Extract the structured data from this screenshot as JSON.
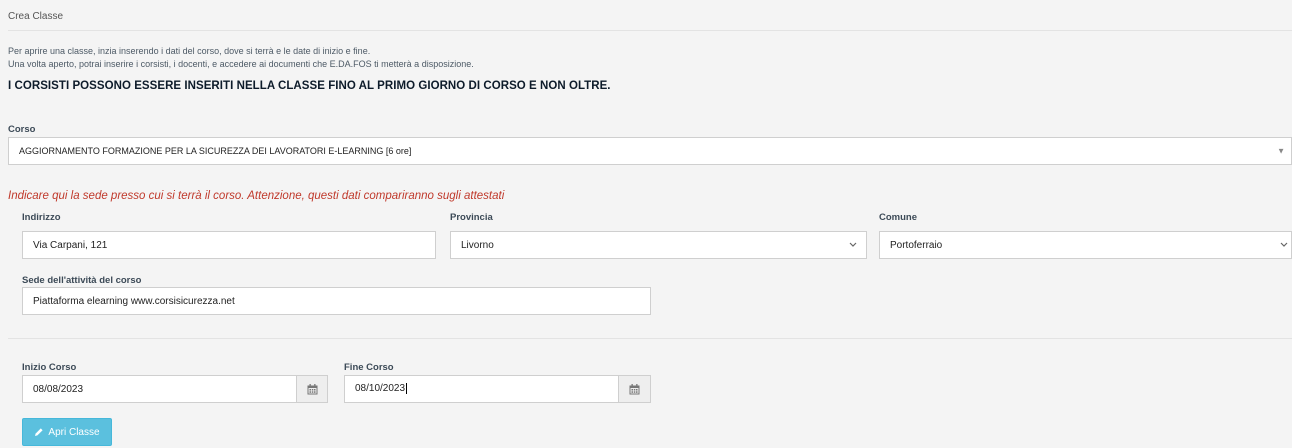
{
  "panel": {
    "title": "Crea Classe"
  },
  "intro": {
    "line1": "Per aprire una classe, inzia inserendo i dati del corso, dove si terrà e le date di inizio e fine.",
    "line2": "Una volta aperto, potrai inserire i corsisti, i docenti, e accedere ai documenti che E.DA.FOS ti metterà a disposizione.",
    "warning": "I CORSISTI POSSONO ESSERE INSERITI NELLA CLASSE FINO AL PRIMO GIORNO DI CORSO E NON OLTRE."
  },
  "corso": {
    "label": "Corso",
    "value": "AGGIORNAMENTO FORMAZIONE PER LA SICUREZZA DEI LAVORATORI E-LEARNING [6 ore]"
  },
  "sede_note": "Indicare qui la sede presso cui si terrà il corso. Attenzione, questi dati compariranno sugli attestati",
  "indirizzo": {
    "label": "Indirizzo",
    "value": "Via Carpani, 121"
  },
  "provincia": {
    "label": "Provincia",
    "value": "Livorno"
  },
  "comune": {
    "label": "Comune",
    "value": "Portoferraio"
  },
  "sede_attivita": {
    "label": "Sede dell'attività del corso",
    "value": "Piattaforma elearning www.corsisicurezza.net"
  },
  "inizio": {
    "label": "Inizio Corso",
    "value": "08/08/2023",
    "icon": "calendar-icon"
  },
  "fine": {
    "label": "Fine Corso",
    "value": "08/10/2023",
    "icon": "calendar-icon"
  },
  "apri_button": {
    "label": "Apri Classe",
    "icon": "pencil-icon"
  },
  "colors": {
    "note": "#c0392b",
    "button": "#5bc0de",
    "warning": "#0d1b2a"
  }
}
